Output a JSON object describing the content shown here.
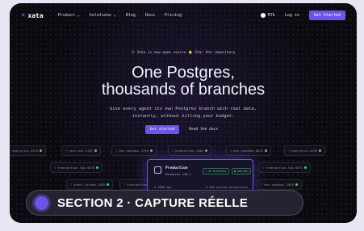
{
  "nav": {
    "logo": "xata",
    "links": [
      "Product ⌄",
      "Solutions ⌄",
      "Blog",
      "Docs",
      "Pricing"
    ],
    "github_stars": "M7k",
    "login": "Log in",
    "get_started": "Get Started"
  },
  "hero": {
    "announcement": "ⓟ Xata is now open source ⭐ Star the repository",
    "title_line1": "One Postgres,",
    "title_line2": "thousands of branches",
    "subtitle_line1": "Give every agent its own Postgres branch with real data,",
    "subtitle_line2": "instantly, without killing your budget.",
    "cta_primary": "Get started",
    "cta_secondary": "Read the docs"
  },
  "branches": [
    "analytics-5474",
    "test-env-4787",
    "dev-sandbox-3796",
    "production-7400",
    "dev-sandbox-8023",
    "analytics-8295",
    "transaction-log-5078",
    "transaction-log-5071",
    "event-stream-1905",
    "transaction-log-4001",
    "dev-sandbox-2005"
  ],
  "production_card": {
    "name": "Production",
    "version": "Postgres v18.1",
    "badge_1": "⌥ 45 branches",
    "badge_2": "● healthy",
    "metric_1": "⊕ 1000 tps",
    "metric_2": "⊕ 245 active connections"
  },
  "overlay": {
    "label": "SECTION 2 · CAPTURE RÉELLE",
    "accent": "#6a55e8"
  }
}
